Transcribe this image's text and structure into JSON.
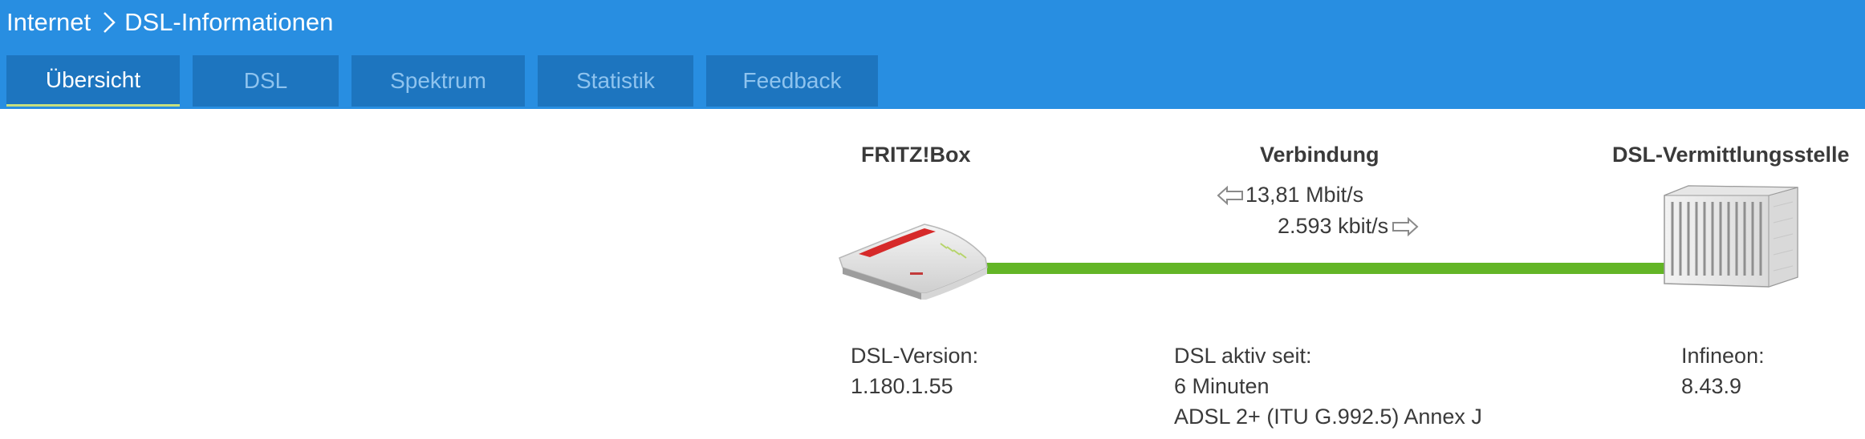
{
  "breadcrumb": {
    "root": "Internet",
    "current": "DSL-Informationen"
  },
  "tabs": [
    {
      "label": "Übersicht",
      "active": true
    },
    {
      "label": "DSL",
      "active": false
    },
    {
      "label": "Spektrum",
      "active": false
    },
    {
      "label": "Statistik",
      "active": false
    },
    {
      "label": "Feedback",
      "active": false
    }
  ],
  "columns": {
    "fritzbox": "FRITZ!Box",
    "connection": "Verbindung",
    "exchange": "DSL-Vermittlungsstelle"
  },
  "connection": {
    "downstream": "13,81 Mbit/s",
    "upstream": "2.593 kbit/s",
    "status_color": "#63b526"
  },
  "fritzbox_info": {
    "label": "DSL-Version:",
    "value": "1.180.1.55"
  },
  "connection_info": {
    "label": "DSL aktiv seit:",
    "value": "6 Minuten",
    "standard": "ADSL 2+ (ITU G.992.5) Annex J"
  },
  "exchange_info": {
    "label": "Infineon:",
    "value": "8.43.9"
  },
  "colors": {
    "header": "#288ee1",
    "tab": "#1d75bf",
    "tab_active_underline": "#c6e07f",
    "line": "#63b526"
  }
}
